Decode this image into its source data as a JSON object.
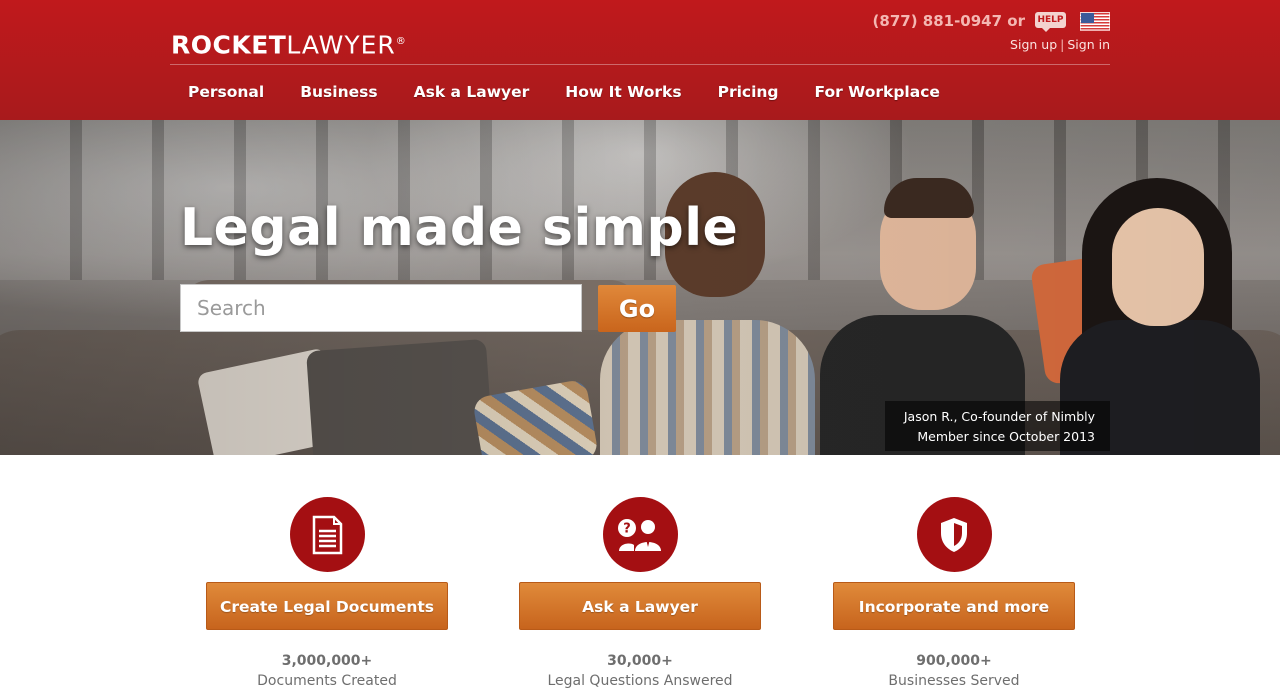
{
  "header": {
    "logo_bold": "ROCKET",
    "logo_light": "LAWYER",
    "logo_mark": "®",
    "phone": "(877) 881-0947 or",
    "help_label": "HELP",
    "sign_up": "Sign up",
    "separator": "|",
    "sign_in": "Sign in",
    "icons": {
      "help": "help-bubble-icon",
      "flag": "us-flag-icon"
    }
  },
  "nav": {
    "items": [
      {
        "label": "Personal"
      },
      {
        "label": "Business"
      },
      {
        "label": "Ask a Lawyer"
      },
      {
        "label": "How It Works"
      },
      {
        "label": "Pricing"
      },
      {
        "label": "For Workplace"
      }
    ]
  },
  "hero": {
    "headline": "Legal made simple",
    "search_placeholder": "Search",
    "search_value": "",
    "go_label": "Go",
    "caption_line1": "Jason R., Co-founder of Nimbly",
    "caption_line2": "Member since October 2013"
  },
  "features": [
    {
      "icon": "document-icon",
      "button": "Create Legal Documents",
      "stat": "3,000,000+",
      "stat_label": "Documents Created"
    },
    {
      "icon": "lawyer-question-icon",
      "button": "Ask a Lawyer",
      "stat": "30,000+",
      "stat_label": "Legal Questions Answered"
    },
    {
      "icon": "shield-icon",
      "button": "Incorporate and more",
      "stat": "900,000+",
      "stat_label": "Businesses Served"
    }
  ],
  "colors": {
    "brand_red": "#c0191c",
    "feature_circle": "#a40f12",
    "button_orange": "#d87a2c"
  }
}
